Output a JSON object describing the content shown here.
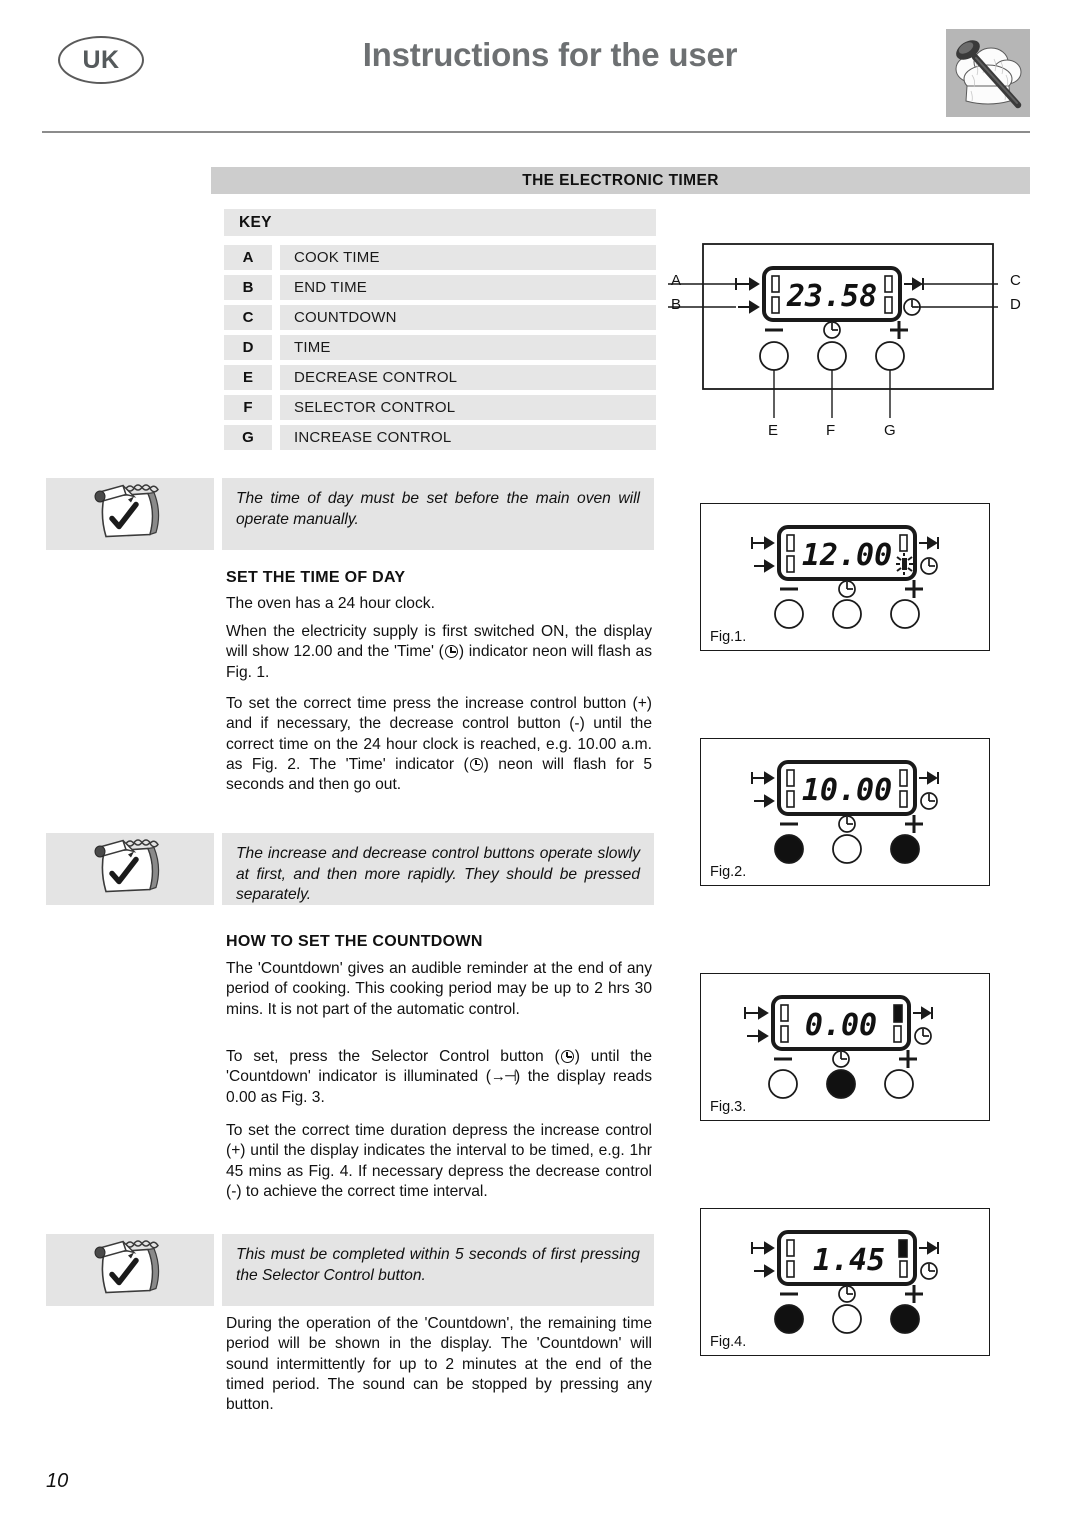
{
  "header": {
    "locale_badge": "UK",
    "title": "Instructions for the user",
    "chef_icon": "chef-hat-spoon-icon"
  },
  "section": {
    "title": "THE ELECTRONIC TIMER"
  },
  "key_table": {
    "heading": "KEY",
    "rows": [
      {
        "letter": "A",
        "label": "COOK TIME"
      },
      {
        "letter": "B",
        "label": "END TIME"
      },
      {
        "letter": "C",
        "label": "COUNTDOWN"
      },
      {
        "letter": "D",
        "label": "TIME"
      },
      {
        "letter": "E",
        "label": "DECREASE CONTROL"
      },
      {
        "letter": "F",
        "label": "SELECTOR CONTROL"
      },
      {
        "letter": "G",
        "label": "INCREASE CONTROL"
      }
    ]
  },
  "notes": [
    {
      "icon": "notepad-check-icon",
      "text": "The time of day must be set before the main oven will operate manually."
    },
    {
      "icon": "notepad-check-icon",
      "text": "The increase and decrease control buttons operate slowly at first, and then more rapidly. They should be pressed separately."
    },
    {
      "icon": "notepad-check-icon",
      "text": "This must be completed within 5 seconds of first pressing the Selector Control button."
    }
  ],
  "sections": {
    "set_time": {
      "heading": "SET THE TIME OF DAY",
      "p1": "The oven has a 24 hour clock.",
      "p2_a": "When the electricity supply is first switched ON, the display will show 12.00 and the 'Time' (",
      "p2_b": ") indicator neon will flash as Fig. 1.",
      "p3_a": "To set the correct time press the increase control button (+) and if necessary, the decrease control button (-) until the correct time on the 24 hour clock is reached, e.g. 10.00 a.m. as Fig. 2. The 'Time' indicator (",
      "p3_b": ") neon will flash for 5 seconds and then go out."
    },
    "countdown": {
      "heading": "HOW TO SET THE COUNTDOWN",
      "p1": "The 'Countdown' gives an audible reminder at the end of any period of cooking. This cooking period may be up to 2 hrs 30 mins. It is not part of the automatic control.",
      "p2_a": "To set, press the Selector Control button (",
      "p2_mid": ") until the 'Countdown' indicator is illuminated (",
      "p2_arrow": "→⊣",
      "p2_b": ") the display reads 0.00 as Fig. 3.",
      "p3": "To set the correct time duration depress the increase control (+) until the display indicates the interval to be timed, e.g. 1hr 45 mins as Fig. 4. If necessary depress the decrease control (-) to achieve the correct time interval.",
      "p4": "During the operation of the 'Countdown', the remaining time period will be shown in the display. The 'Countdown' will sound intermittently for up to 2 minutes at the end of the timed period. The sound can be stopped by pressing any button."
    }
  },
  "diagrams": {
    "main": {
      "display_value": "23.58",
      "callouts": {
        "a": "A",
        "b": "B",
        "c": "C",
        "d": "D",
        "e": "E",
        "f": "F",
        "g": "G"
      },
      "buttons": [
        {
          "name": "decrease-control",
          "glyph": "−",
          "pressed": false
        },
        {
          "name": "selector-control",
          "glyph": "clock-icon",
          "pressed": false
        },
        {
          "name": "increase-control",
          "glyph": "+",
          "pressed": false
        }
      ],
      "indicators": {
        "cook_time": "off",
        "end_time": "off",
        "countdown": "off",
        "time": "off"
      }
    },
    "figures": [
      {
        "label": "Fig.1.",
        "display_value": "12.00",
        "time_indicator_flashing": true,
        "buttons": [
          {
            "name": "decrease-control",
            "glyph": "−",
            "pressed": false
          },
          {
            "name": "selector-control",
            "glyph": "clock-icon",
            "pressed": false
          },
          {
            "name": "increase-control",
            "glyph": "+",
            "pressed": false
          }
        ]
      },
      {
        "label": "Fig.2.",
        "display_value": "10.00",
        "time_indicator_flashing": false,
        "buttons": [
          {
            "name": "decrease-control",
            "glyph": "−",
            "pressed": true
          },
          {
            "name": "selector-control",
            "glyph": "clock-icon",
            "pressed": false
          },
          {
            "name": "increase-control",
            "glyph": "+",
            "pressed": true
          }
        ]
      },
      {
        "label": "Fig.3.",
        "display_value": "0.00",
        "countdown_indicator_on": true,
        "buttons": [
          {
            "name": "decrease-control",
            "glyph": "−",
            "pressed": false
          },
          {
            "name": "selector-control",
            "glyph": "clock-icon",
            "pressed": true
          },
          {
            "name": "increase-control",
            "glyph": "+",
            "pressed": false
          }
        ]
      },
      {
        "label": "Fig.4.",
        "display_value": "1.45",
        "countdown_indicator_on": true,
        "buttons": [
          {
            "name": "decrease-control",
            "glyph": "−",
            "pressed": true
          },
          {
            "name": "selector-control",
            "glyph": "clock-icon",
            "pressed": false
          },
          {
            "name": "increase-control",
            "glyph": "+",
            "pressed": true
          }
        ]
      }
    ]
  },
  "footer": {
    "page_number": "10"
  },
  "colors": {
    "header_text": "#6d7072",
    "section_bar": "#cdcdcd",
    "table_cell": "#e6e6e6",
    "note_bg": "#e4e4e4",
    "ink": "#111111",
    "chef_bg": "#b6b6b6"
  }
}
